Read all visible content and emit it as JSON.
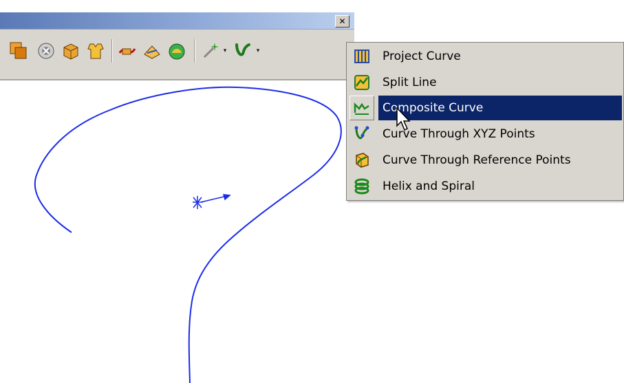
{
  "window": {
    "close_glyph": "✕"
  },
  "toolbar": {
    "icons": [
      "combine-faces-icon",
      "delete-face-icon",
      "move-face-icon",
      "shirt-shape-icon",
      "knit-curve-icon",
      "loft-surface-icon",
      "fill-surface-icon",
      "sketch-point-icon",
      "curves-icon"
    ],
    "dropdown_glyph": "▾"
  },
  "menu": {
    "items": [
      {
        "label": "Project Curve",
        "icon": "project-curve-icon"
      },
      {
        "label": "Split Line",
        "icon": "split-line-icon"
      },
      {
        "label": "Composite Curve",
        "icon": "composite-curve-icon",
        "highlighted": true
      },
      {
        "label": "Curve Through XYZ Points",
        "icon": "curve-xyz-points-icon"
      },
      {
        "label": "Curve Through Reference Points",
        "icon": "curve-reference-points-icon"
      },
      {
        "label": "Helix and Spiral",
        "icon": "helix-spiral-icon"
      }
    ]
  },
  "colors": {
    "curve": "#1a2be8",
    "highlight": "#0c2468",
    "menu_bg": "#d9d6cf"
  }
}
